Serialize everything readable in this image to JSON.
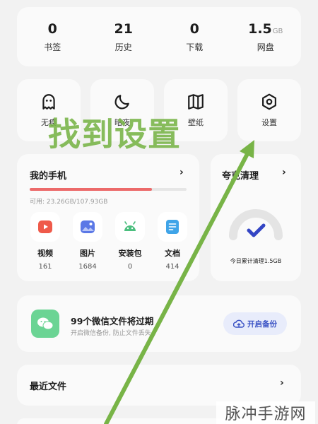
{
  "stats": [
    {
      "value": "0",
      "unit": "",
      "label": "书签"
    },
    {
      "value": "21",
      "unit": "",
      "label": "历史"
    },
    {
      "value": "0",
      "unit": "",
      "label": "下载"
    },
    {
      "value": "1.5",
      "unit": "GB",
      "label": "网盘"
    }
  ],
  "tiles": [
    {
      "label": "无痕",
      "icon": "ghost-icon"
    },
    {
      "label": "暗夜",
      "icon": "moon-icon"
    },
    {
      "label": "壁纸",
      "icon": "book-icon"
    },
    {
      "label": "设置",
      "icon": "settings-hexagon-icon"
    }
  ],
  "phone": {
    "title": "我的手机",
    "storage_used_fraction": 0.78,
    "available_text": "可用: 23.26GB/107.93GB",
    "categories": [
      {
        "label": "视频",
        "count": "161",
        "icon": "video-icon",
        "color": "#ef5a4a"
      },
      {
        "label": "图片",
        "count": "1684",
        "icon": "image-icon",
        "color": "#5b78e6"
      },
      {
        "label": "安装包",
        "count": "0",
        "icon": "android-icon",
        "color": "#4cbf7f"
      },
      {
        "label": "文档",
        "count": "414",
        "icon": "document-icon",
        "color": "#3fa4e8"
      }
    ]
  },
  "clean": {
    "title": "夸克清理",
    "note": "今日累计清理1.5GB"
  },
  "wechat": {
    "title": "99个微信文件将过期",
    "subtitle": "开启微信备份, 防止文件丢失",
    "button": "开启备份"
  },
  "recent": {
    "title": "最近文件"
  },
  "overlay": {
    "text": "找到设置",
    "watermark": "脉冲手游网"
  },
  "colors": {
    "accent_green": "#78b447",
    "storage_bar": "#ec6a6a",
    "check_blue": "#3345c4",
    "backup_blue": "#3b53c5"
  }
}
